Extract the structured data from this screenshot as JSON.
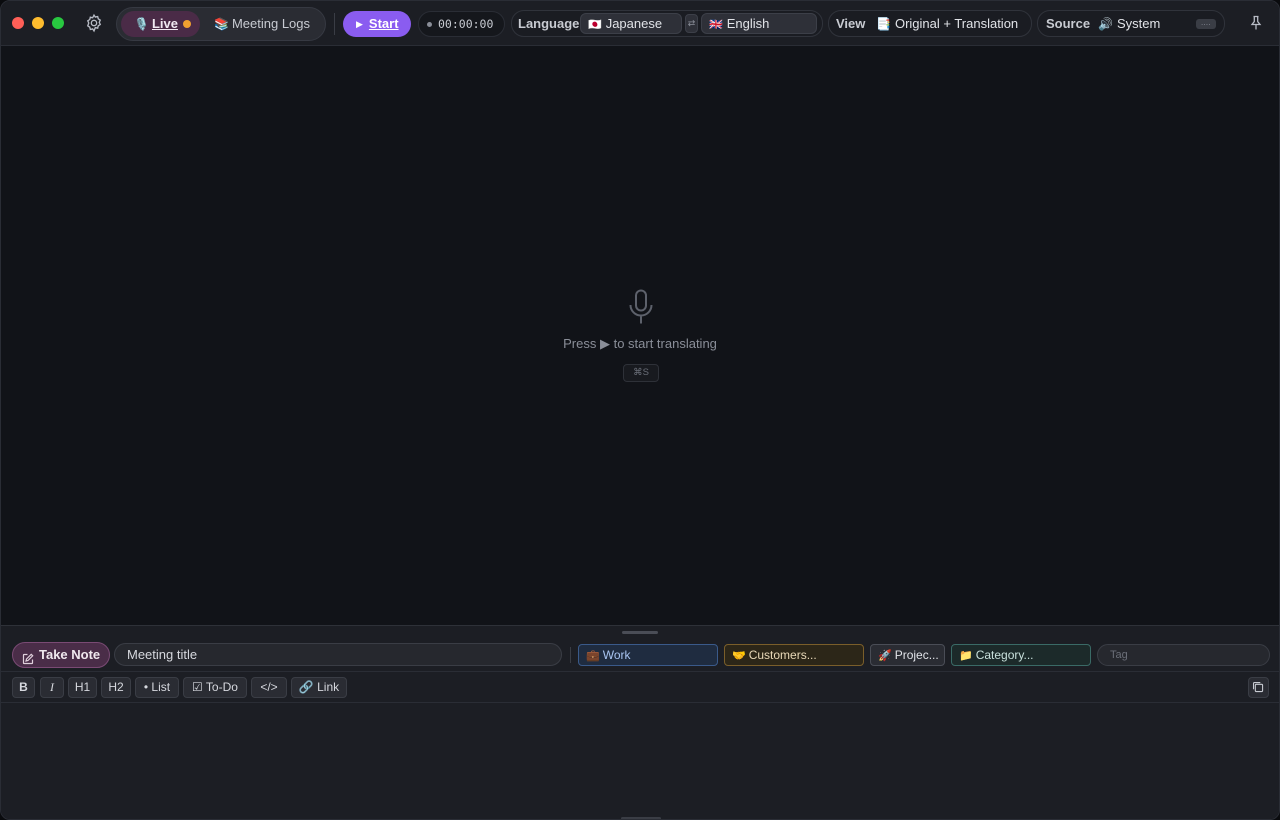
{
  "toolbar": {
    "tabs": {
      "live_label": "Live",
      "live_emoji": "🎙️",
      "logs_label": "Meeting Logs",
      "logs_emoji": "📚"
    },
    "start_label": "Start",
    "timer": "00:00:00",
    "language": {
      "label": "Language",
      "source": "Japanese",
      "source_flag": "🇯🇵",
      "target": "English",
      "target_flag": "🇬🇧",
      "swap_glyph": "⇄"
    },
    "view": {
      "label": "View",
      "value": "Original + Translation",
      "emoji": "📑"
    },
    "source": {
      "label": "Source",
      "value": "System",
      "emoji": "🔊",
      "meter": "...."
    }
  },
  "main": {
    "hint_before": "Press",
    "hint_after": "to start translating",
    "shortcut": "⌘S"
  },
  "notes": {
    "take_note_label": "Take Note",
    "title_value": "Meeting title",
    "tags": [
      {
        "label": "Work",
        "emoji": "💼"
      },
      {
        "label": "Customers...",
        "emoji": "🤝"
      },
      {
        "label": "Projec...",
        "emoji": "🚀"
      },
      {
        "label": "Category...",
        "emoji": "📁"
      }
    ],
    "tag_placeholder": "Tag",
    "format": {
      "bold": "B",
      "italic": "I",
      "h1": "H1",
      "h2": "H2",
      "list": "• List",
      "todo": "☑ To-Do",
      "code": "</>",
      "link": "🔗 Link"
    }
  },
  "colors": {
    "accent": "#8a5cf0",
    "live_bg": "#4a2b47",
    "recording_dot": "#f0a030"
  }
}
